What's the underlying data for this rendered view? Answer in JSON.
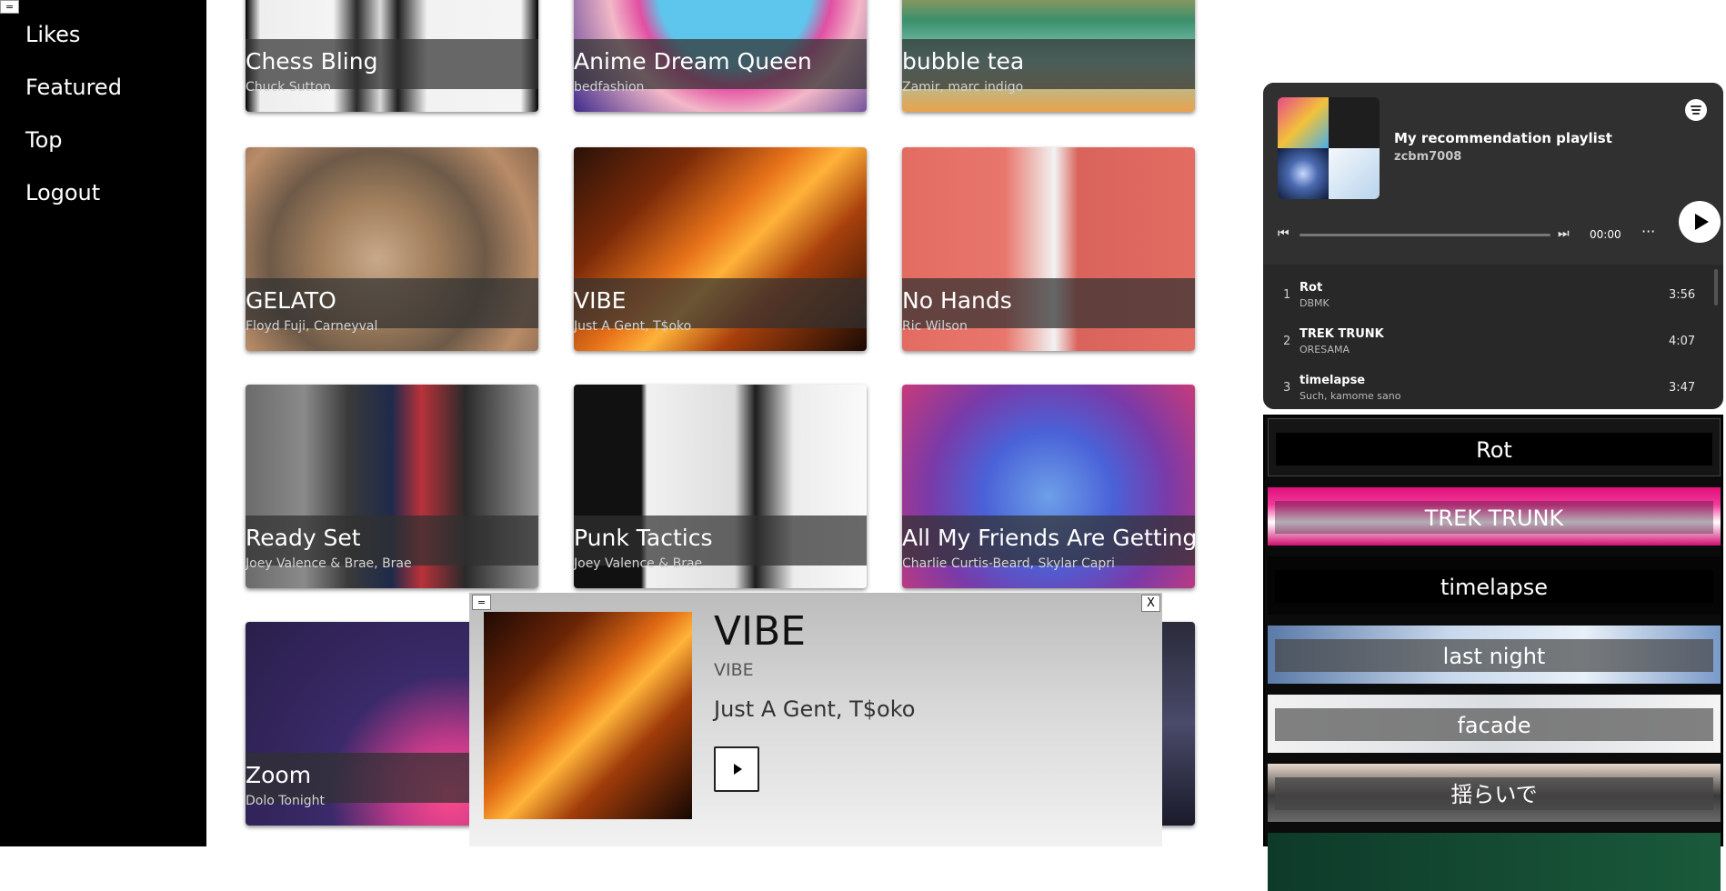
{
  "menu_toggle": "=",
  "nav": {
    "items": [
      "Likes",
      "Featured",
      "Top",
      "Logout"
    ]
  },
  "grid": {
    "cards": [
      {
        "title": "Chess Bling",
        "artist": "Chuck Sutton"
      },
      {
        "title": "Anime Dream Queen",
        "artist": "bedfashion"
      },
      {
        "title": "bubble tea",
        "artist": "Zamir, marc indigo"
      },
      {
        "title": "GELATO",
        "artist": "Floyd Fuji, Carneyval"
      },
      {
        "title": "VIBE",
        "artist": "Just A Gent, T$oko"
      },
      {
        "title": "No Hands",
        "artist": "Ric Wilson"
      },
      {
        "title": "Ready Set",
        "artist": "Joey Valence & Brae, Brae"
      },
      {
        "title": "Punk Tactics",
        "artist": "Joey Valence & Brae"
      },
      {
        "title": "All My Friends Are Getting M",
        "artist": "Charlie Curtis-Beard, Skylar Capri"
      },
      {
        "title": "Zoom",
        "artist": "Dolo Tonight"
      }
    ]
  },
  "embed": {
    "playlist_title": "My recommendation playlist",
    "owner": "zcbm7008",
    "time": "00:00",
    "more": "···",
    "prev_icon": "skip-previous-icon",
    "next_icon": "skip-next-icon",
    "logo_icon": "spotify-logo-icon",
    "tracks": [
      {
        "num": "1",
        "name": "Rot",
        "artist": "DBMK",
        "duration": "3:56"
      },
      {
        "num": "2",
        "name": "TREK TRUNK",
        "artist": "ORESAMA",
        "duration": "4:07"
      },
      {
        "num": "3",
        "name": "timelapse",
        "artist": "Such, kamome sano",
        "duration": "3:47"
      }
    ]
  },
  "queue": {
    "items": [
      "Rot",
      "TREK TRUNK",
      "timelapse",
      "last night",
      "facade",
      "揺らいで"
    ]
  },
  "modal": {
    "minimize": "=",
    "close": "X",
    "title": "VIBE",
    "album": "VIBE",
    "artists": "Just A Gent, T$oko",
    "play_icon": "play-icon"
  },
  "colors": {
    "sidebar_bg": "#000000",
    "embed_bg": "#282828",
    "card_overlay": "#303030"
  }
}
